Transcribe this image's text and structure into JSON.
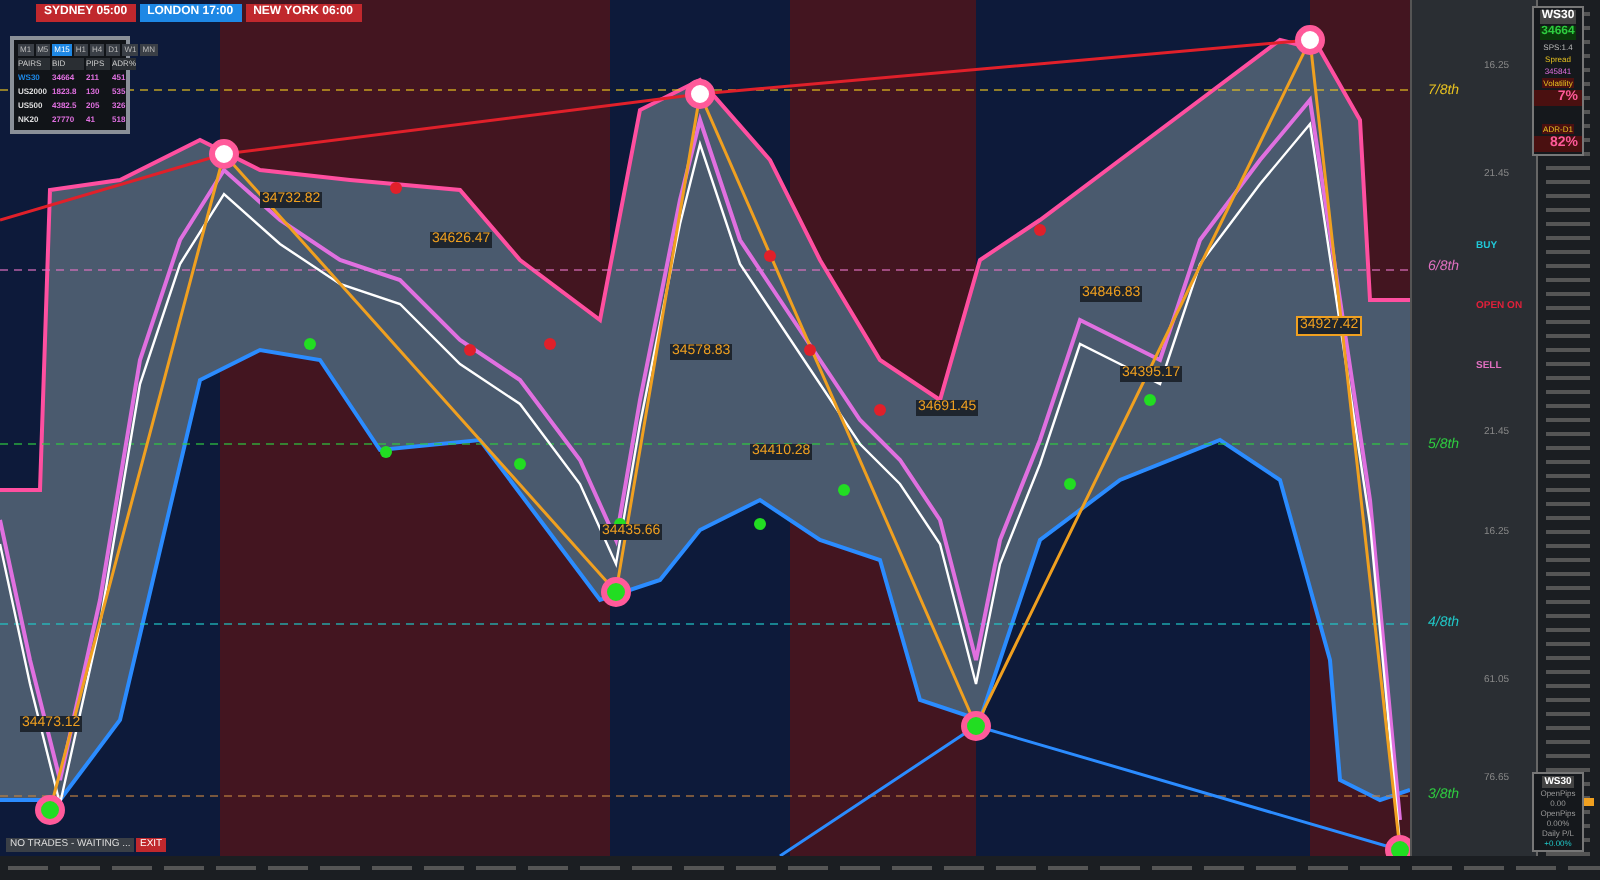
{
  "session_tabs": [
    {
      "label": "SYDNEY 05:00",
      "color": "#c0282d"
    },
    {
      "label": "LONDON 17:00",
      "color": "#1e88e5"
    },
    {
      "label": "NEW YORK 06:00",
      "color": "#c0282d"
    }
  ],
  "timeframes": [
    {
      "label": "M1",
      "selected": false
    },
    {
      "label": "M5",
      "selected": false
    },
    {
      "label": "M15",
      "selected": true
    },
    {
      "label": "H1",
      "selected": false
    },
    {
      "label": "H4",
      "selected": false
    },
    {
      "label": "D1",
      "selected": false
    },
    {
      "label": "W1",
      "selected": false
    },
    {
      "label": "MN",
      "selected": false
    }
  ],
  "watchlist": {
    "columns": [
      "PAIRS",
      "BID",
      "PIPS",
      "ADR%"
    ],
    "rows": [
      {
        "cells": [
          "WS30",
          "34664",
          "211",
          "451"
        ],
        "color": "#1e88e5"
      },
      {
        "cells": [
          "US2000",
          "1823.8",
          "130",
          "535"
        ],
        "color": "#dddddd"
      },
      {
        "cells": [
          "US500",
          "4382.5",
          "205",
          "326"
        ],
        "color": "#dddddd"
      },
      {
        "cells": [
          "NK20",
          "27770",
          "41",
          "518"
        ],
        "color": "#dddddd"
      }
    ]
  },
  "chart_labels": [
    "34732.82",
    "34626.47",
    "34578.83",
    "34846.83",
    "34691.45",
    "34927.42",
    "34473.12",
    "34435.66",
    "34410.28",
    "34395.17"
  ],
  "level_labels": [
    {
      "label": "7/8th",
      "color": "#e8c220"
    },
    {
      "label": "6/8th",
      "color": "#e070c0"
    },
    {
      "label": "5/8th",
      "color": "#2ecc40"
    },
    {
      "label": "4/8th",
      "color": "#20c8c8"
    },
    {
      "label": "3/8th",
      "color": "#2ecc40"
    }
  ],
  "grid_labels": [
    "16.25",
    "21.45",
    "21.45",
    "16.25",
    "61.05",
    "76.65"
  ],
  "signals": [
    {
      "label": "BUY",
      "color": "#20c8d8"
    },
    {
      "label": "OPEN ON",
      "color": "#e0203a"
    },
    {
      "label": "SELL",
      "color": "#e070c0"
    }
  ],
  "info_panel": {
    "symbol": "WS30",
    "price": "34664",
    "sps": "SPS:1.4",
    "spread_label": "Spread",
    "spread": "345841",
    "volatility_label": "Volatility",
    "volatility": "7%",
    "adr_label": "ADR-D1",
    "adr": "82%"
  },
  "pnl_panel": {
    "symbol": "WS30",
    "items": [
      {
        "label": "OpenPips",
        "value": "0.00"
      },
      {
        "label": "OpenPips",
        "value": "0.00%"
      },
      {
        "label": "Daily P/L",
        "value": "+0.00%"
      }
    ]
  },
  "status": "NO TRADES - WAITING ...",
  "status_badge": "EXIT"
}
